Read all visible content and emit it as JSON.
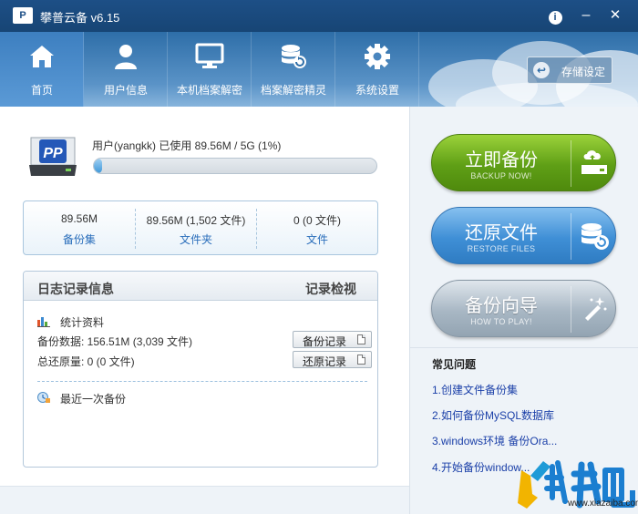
{
  "window": {
    "title": "攀普云备 v6.15",
    "logo_text": "P",
    "info_label": "i",
    "minimize_label": "–",
    "close_label": "✕"
  },
  "toolbar": {
    "items": [
      {
        "label": "首页",
        "icon": "home-icon"
      },
      {
        "label": "用户信息",
        "icon": "user-icon"
      },
      {
        "label": "本机档案解密",
        "icon": "monitor-icon"
      },
      {
        "label": "档案解密精灵",
        "icon": "database-restore-icon"
      },
      {
        "label": "系统设置",
        "icon": "gear-icon"
      }
    ],
    "storage_button": {
      "label": "存储设定",
      "icon_glyph": "↩"
    }
  },
  "usage": {
    "text": "用户(yangkk)  已使用  89.56M / 5G (1%)",
    "percent": 1
  },
  "stats": [
    {
      "value": "89.56M",
      "label": "备份集"
    },
    {
      "value": "89.56M  (1,502 文件)",
      "label": "文件夹"
    },
    {
      "value": "0  (0 文件)",
      "label": "文件"
    }
  ],
  "log": {
    "title": "日志记录信息",
    "view_link": "记录检视",
    "stats_heading": "统计资料",
    "backup_data": "备份数据: 156.51M  (3,039 文件)",
    "restore_total": "总还原量: 0  (0 文件)",
    "backup_records_button": "备份记录",
    "restore_records_button": "还原记录",
    "last_backup": "最近一次备份"
  },
  "actions": {
    "backup": {
      "label": "立即备份",
      "sub": "BACKUP NOW!",
      "color": "#6aa91c"
    },
    "restore": {
      "label": "还原文件",
      "sub": "RESTORE FILES",
      "color": "#3f8fd6"
    },
    "guide": {
      "label": "备份向导",
      "sub": "HOW TO PLAY!",
      "color": "#a8b7c4"
    }
  },
  "faq": {
    "title": "常见问题",
    "items": [
      "1.创建文件备份集",
      "2.如何备份MySQL数据库",
      "3.windows环境 备份Ora...",
      "4.开始备份window..."
    ]
  },
  "watermark": {
    "text": "www.xiazaiba.com",
    "logo_text": "下载吧"
  }
}
